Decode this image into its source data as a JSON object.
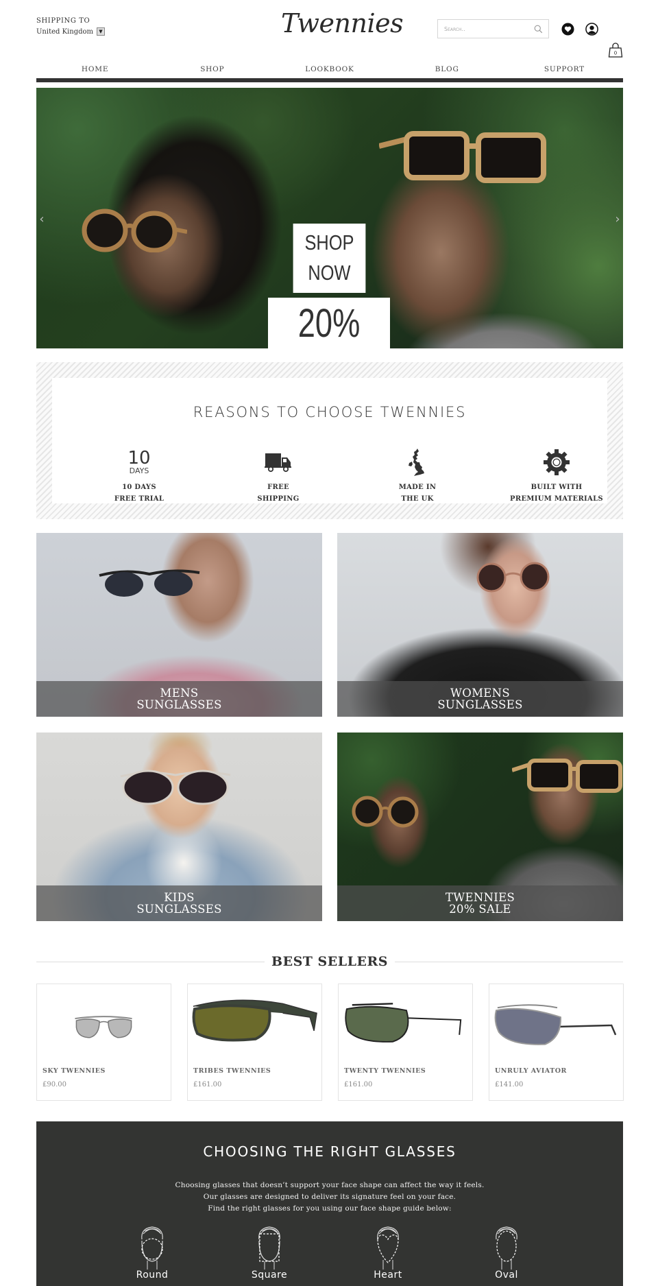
{
  "header": {
    "shipping_label": "SHIPPING TO",
    "shipping_country": "United Kingdom",
    "logo": "Twennies",
    "search_placeholder": "Search..",
    "icons": {
      "search": "search-icon",
      "wishlist": "heart-icon",
      "account": "user-icon",
      "cart": "shopping-bag-icon"
    },
    "cart_count": "0"
  },
  "nav": [
    {
      "label": "HOME"
    },
    {
      "label": "SHOP"
    },
    {
      "label": "LOOKBOOK"
    },
    {
      "label": "BLOG"
    },
    {
      "label": "SUPPORT"
    }
  ],
  "hero": {
    "cta_line1": "SHOP",
    "cta_line2": "NOW",
    "discount": "20%",
    "prev_arrow": "‹",
    "next_arrow": "›"
  },
  "reasons": {
    "title": "REASONS TO CHOOSE TWENNIES",
    "items": [
      {
        "icon": "10-days-icon",
        "big": "10",
        "small": "DAYS",
        "line1": "10 DAYS",
        "line2": "FREE TRIAL"
      },
      {
        "icon": "truck-icon",
        "line1": "FREE",
        "line2": "SHIPPING"
      },
      {
        "icon": "uk-map-icon",
        "line1": "MADE IN",
        "line2": "THE UK"
      },
      {
        "icon": "gear-icon",
        "line1": "BUILT WITH",
        "line2": "PREMIUM MATERIALS"
      }
    ]
  },
  "categories": [
    {
      "line1": "MENS",
      "line2": "SUNGLASSES"
    },
    {
      "line1": "WOMENS",
      "line2": "SUNGLASSES"
    },
    {
      "line1": "KIDS",
      "line2": "SUNGLASSES"
    },
    {
      "line1": "TWENNIES",
      "line2": "20% SALE"
    }
  ],
  "best_sellers": {
    "title": "BEST SELLERS",
    "products": [
      {
        "name": "SKY TWENNIES",
        "price": "£90.00"
      },
      {
        "name": "TRIBES TWENNIES",
        "price": "£161.00"
      },
      {
        "name": "TWENTY TWENNIES",
        "price": "£161.00"
      },
      {
        "name": "UNRULY AVIATOR",
        "price": "£141.00"
      }
    ]
  },
  "guide": {
    "title": "CHOOSING THE RIGHT GLASSES",
    "lines": [
      "Choosing glasses that doesn’t support your face shape can affect the way it feels.",
      "Our glasses are designed to deliver its signature feel on your face.",
      "Find the right glasses for you using our face shape guide below:"
    ],
    "faces": [
      {
        "label": "Round"
      },
      {
        "label": "Square"
      },
      {
        "label": "Heart"
      },
      {
        "label": "Oval"
      }
    ]
  },
  "colors": {
    "text_dark": "#333333",
    "nav_bar": "#333333",
    "guide_bg": "#333432",
    "category_overlay": "#505050",
    "border_light": "#e3e3e3"
  }
}
